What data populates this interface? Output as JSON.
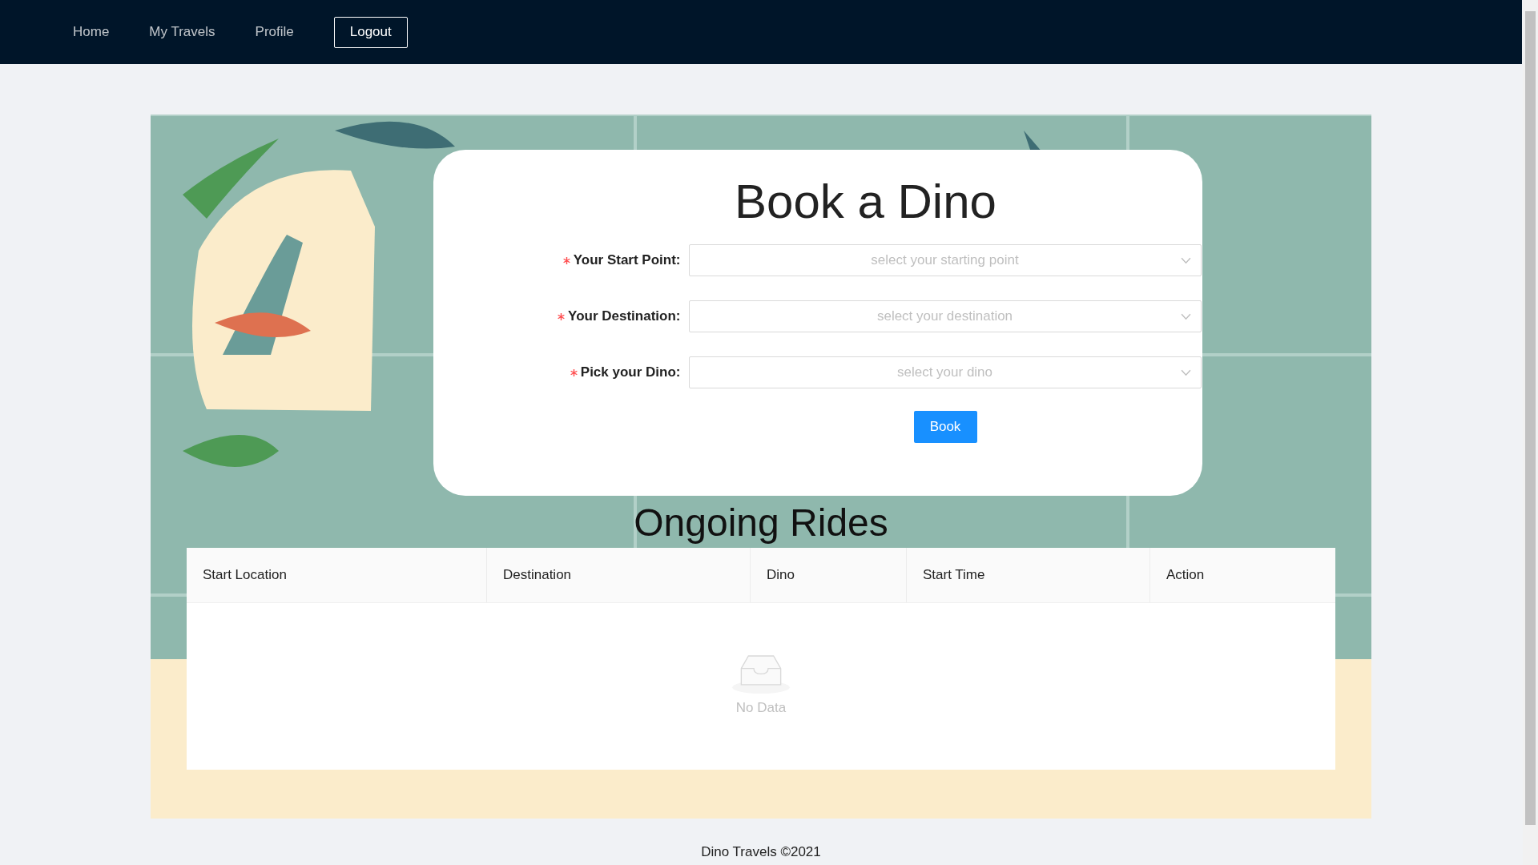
{
  "nav": {
    "links": [
      {
        "label": "Home"
      },
      {
        "label": "My Travels"
      },
      {
        "label": "Profile"
      }
    ],
    "logout": "Logout"
  },
  "booking": {
    "title": "Book a Dino",
    "fields": [
      {
        "label": "Your Start Point:",
        "required": true,
        "placeholder": "select your starting point"
      },
      {
        "label": "Your Destination:",
        "required": true,
        "placeholder": "select your destination"
      },
      {
        "label": "Pick your Dino:",
        "required": true,
        "placeholder": "select your dino"
      }
    ],
    "submit": "Book"
  },
  "rides": {
    "title": "Ongoing Rides",
    "columns": [
      "Start Location",
      "Destination",
      "Dino",
      "Start Time",
      "Action"
    ],
    "empty_text": "No Data"
  },
  "footer": "Dino Travels ©2021"
}
